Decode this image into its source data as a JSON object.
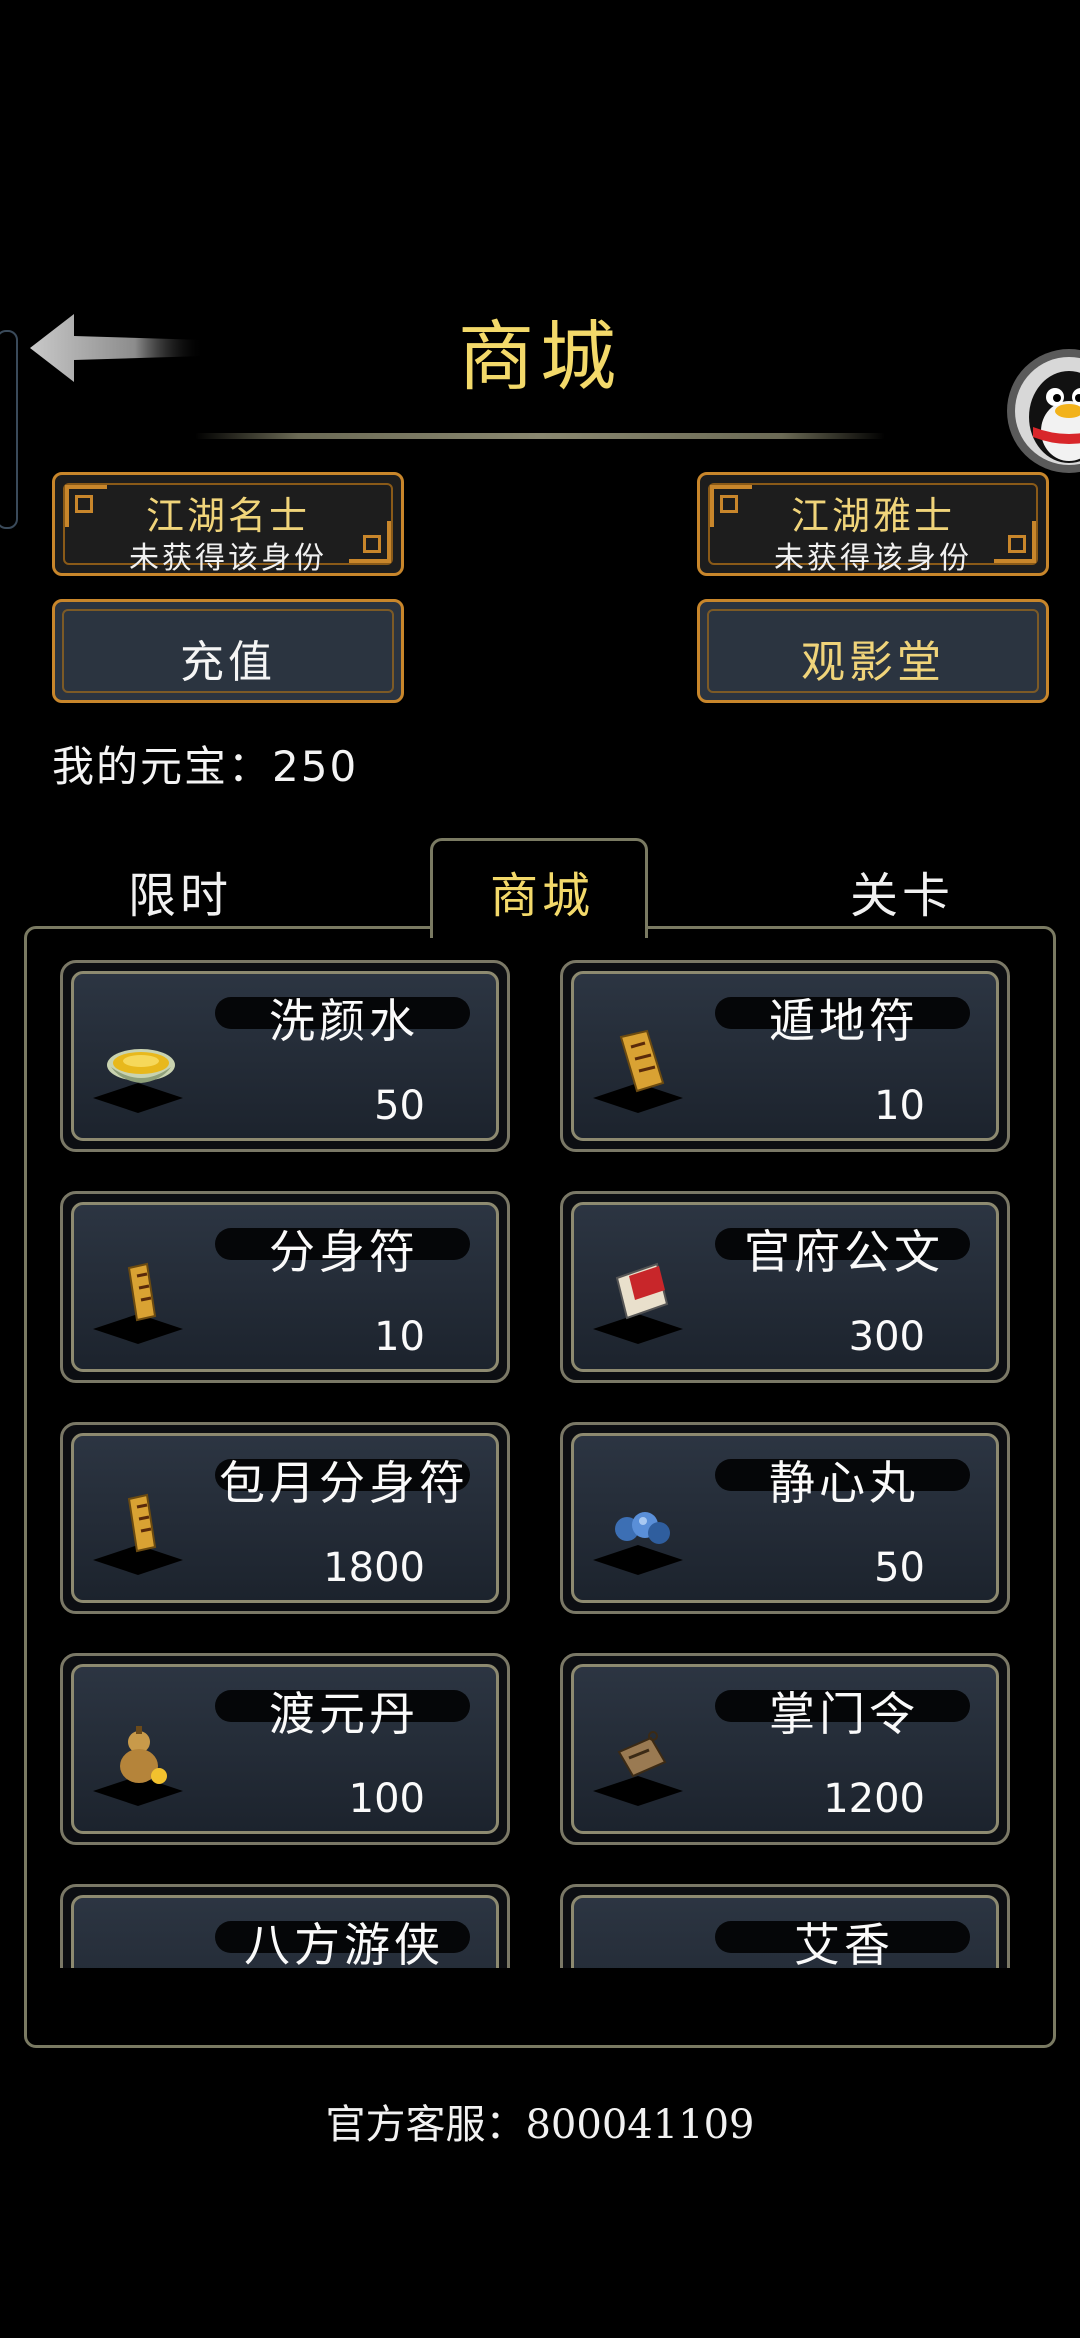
{
  "header": {
    "title": "商城"
  },
  "badges": [
    {
      "title": "江湖名士",
      "subtitle": "未获得该身份"
    },
    {
      "title": "江湖雅士",
      "subtitle": "未获得该身份"
    }
  ],
  "buttons": {
    "recharge": "充值",
    "theater": "观影堂"
  },
  "balance": {
    "label": "我的元宝：",
    "value": "250"
  },
  "tabs": {
    "limited": "限时",
    "shop": "商城",
    "level": "关卡"
  },
  "items": [
    {
      "name": "洗颜水",
      "price": "50",
      "icon": "bowl-icon"
    },
    {
      "name": "遁地符",
      "price": "10",
      "icon": "talisman-icon"
    },
    {
      "name": "分身符",
      "price": "10",
      "icon": "talisman-icon"
    },
    {
      "name": "官府公文",
      "price": "300",
      "icon": "document-icon"
    },
    {
      "name": "包月分身符",
      "price": "1800",
      "icon": "talisman-icon"
    },
    {
      "name": "静心丸",
      "price": "50",
      "icon": "pill-icon"
    },
    {
      "name": "渡元丹",
      "price": "100",
      "icon": "gourd-icon"
    },
    {
      "name": "掌门令",
      "price": "1200",
      "icon": "token-icon"
    },
    {
      "name": "八方游侠",
      "price": "",
      "icon": "mask-icon"
    },
    {
      "name": "艾香",
      "price": "",
      "icon": "incense-icon"
    }
  ],
  "footer": {
    "service": "官方客服：800041109"
  },
  "colors": {
    "gold": "#f3d96a",
    "frame": "#c8862b",
    "panel_border": "#7a7a62",
    "card_face": "#2c3542"
  }
}
